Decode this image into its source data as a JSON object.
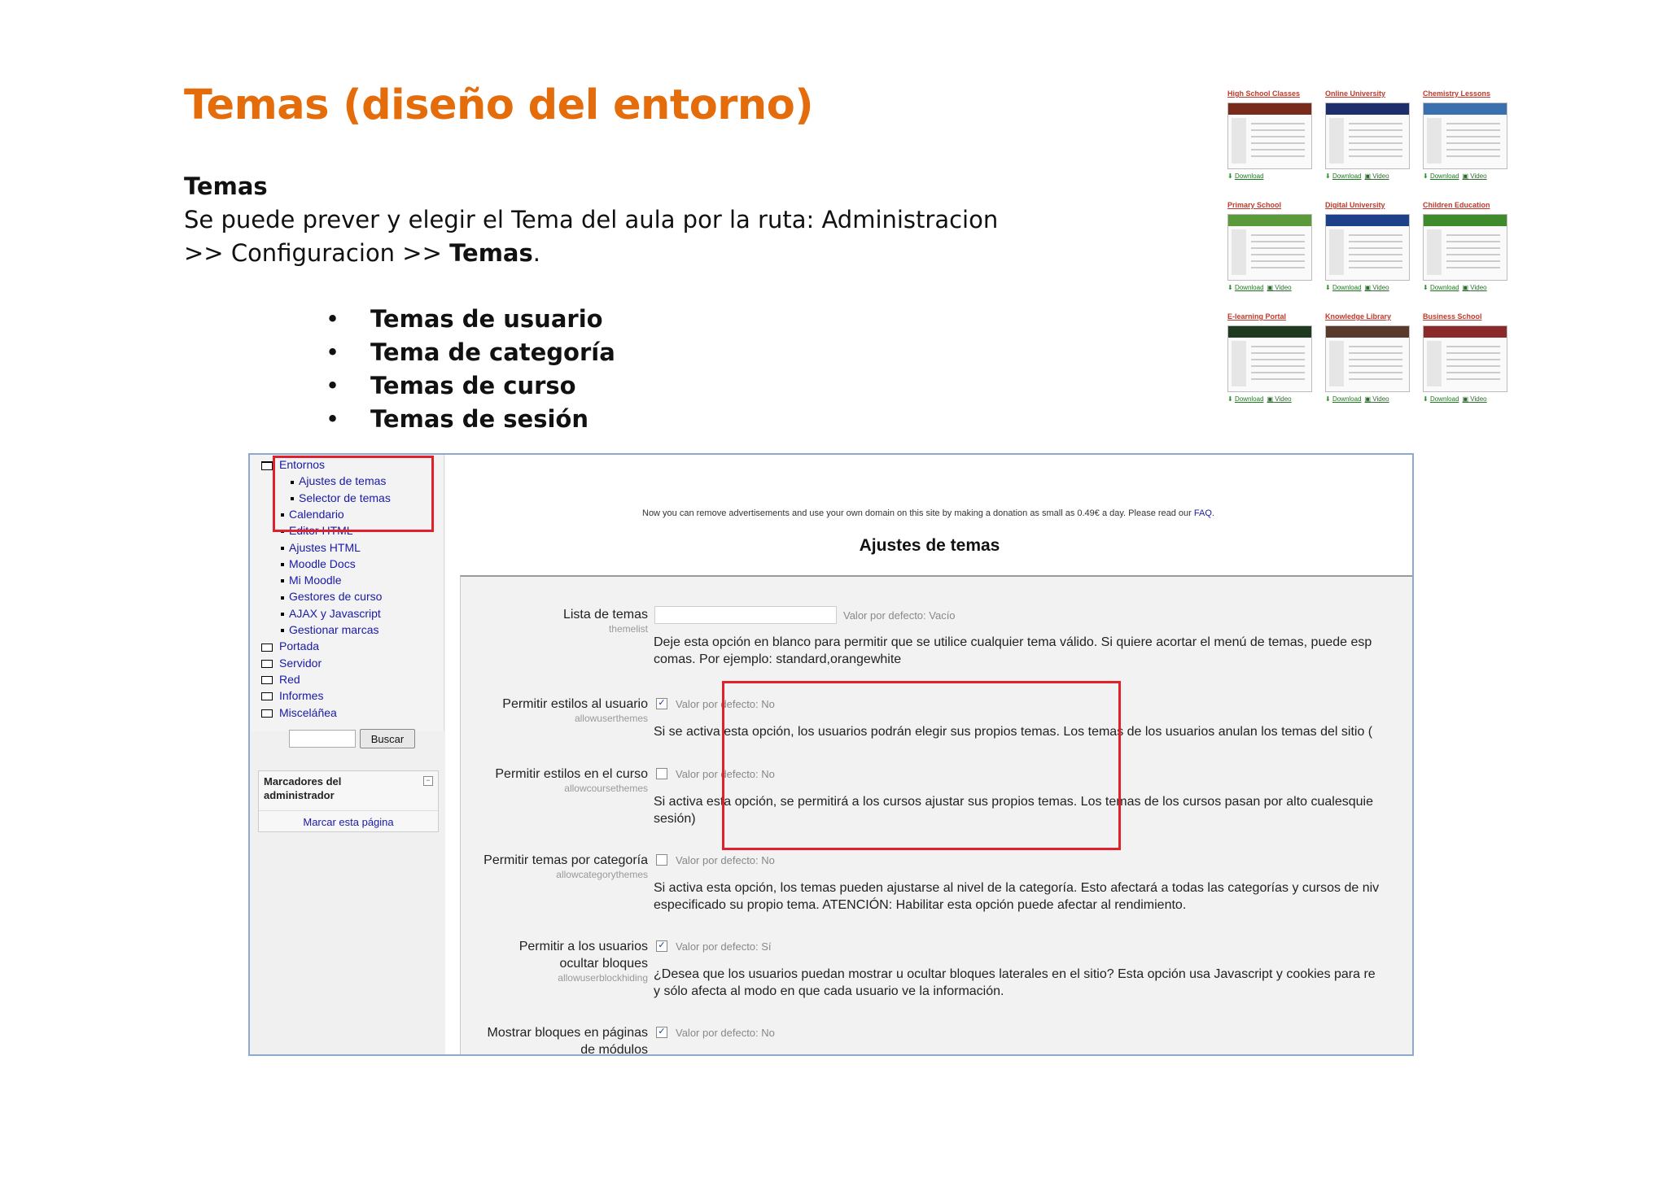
{
  "slide": {
    "title": "Temas (diseño del entorno)",
    "heading": "Temas",
    "intro_prefix": "Se puede prever y elegir el Tema del aula por la ruta: Administracion >> Configuracion >> ",
    "intro_bold": "Temas",
    "intro_suffix": ".",
    "bullet_glyph": "•",
    "bullets": [
      "Temas de usuario",
      "Tema de categoría",
      "Temas de curso",
      "Temas de sesión"
    ]
  },
  "gallery": {
    "download_label": "Download",
    "video_label": "Video",
    "themes": [
      {
        "title": "High School Classes",
        "color": "#7a2a1a",
        "video": false
      },
      {
        "title": "Online University",
        "color": "#1d2d6e",
        "video": true
      },
      {
        "title": "Chemistry Lessons",
        "color": "#3a6fb0",
        "video": true
      },
      {
        "title": "Primary School",
        "color": "#5a9a3a",
        "video": true
      },
      {
        "title": "Digital University",
        "color": "#1e3f8a",
        "video": true
      },
      {
        "title": "Children Education",
        "color": "#3f8a2a",
        "video": true
      },
      {
        "title": "E-learning Portal",
        "color": "#1f3a1f",
        "video": true
      },
      {
        "title": "Knowledge Library",
        "color": "#5a3a2a",
        "video": true
      },
      {
        "title": "Business School",
        "color": "#8a2a2a",
        "video": true
      }
    ]
  },
  "screenshot": {
    "sidebar": {
      "items": [
        {
          "label": "Entornos",
          "kind": "folder-open",
          "indent": 0
        },
        {
          "label": "Ajustes de temas",
          "kind": "leaf",
          "indent": 2
        },
        {
          "label": "Selector de temas",
          "kind": "leaf",
          "indent": 2
        },
        {
          "label": "Calendario",
          "kind": "leaf",
          "indent": 1
        },
        {
          "label": "Editor HTML",
          "kind": "leaf",
          "indent": 1
        },
        {
          "label": "Ajustes HTML",
          "kind": "leaf",
          "indent": 1
        },
        {
          "label": "Moodle Docs",
          "kind": "leaf",
          "indent": 1
        },
        {
          "label": "Mi Moodle",
          "kind": "leaf",
          "indent": 1
        },
        {
          "label": "Gestores de curso",
          "kind": "leaf",
          "indent": 1
        },
        {
          "label": "AJAX y Javascript",
          "kind": "leaf",
          "indent": 1
        },
        {
          "label": "Gestionar marcas",
          "kind": "leaf",
          "indent": 1
        },
        {
          "label": "Portada",
          "kind": "folder",
          "indent": 0
        },
        {
          "label": "Servidor",
          "kind": "folder",
          "indent": 0
        },
        {
          "label": "Red",
          "kind": "folder",
          "indent": 0
        },
        {
          "label": "Informes",
          "kind": "folder",
          "indent": 0
        },
        {
          "label": "Misceláñea",
          "kind": "folder",
          "indent": 0
        }
      ],
      "search_button": "Buscar",
      "bookmarks_title": "Marcadores del administrador",
      "bookmarks_link": "Marcar esta página"
    },
    "notice_text": "Now you can remove advertisements and use your own domain on this site by making a donation as small as 0.49€ a day. Please read our ",
    "notice_link": "FAQ",
    "notice_end": ".",
    "page_heading": "Ajustes de temas",
    "settings": [
      {
        "label": "Lista de temas",
        "key": "themelist",
        "control": "text",
        "default": "Valor por defecto: Vacío",
        "description": "Deje esta opción en blanco para permitir que se utilice cualquier tema válido. Si quiere acortar el menú de temas, puede esp\ncomas. Por ejemplo: standard,orangewhite"
      },
      {
        "label": "Permitir estilos al usuario",
        "key": "allowuserthemes",
        "control": "checkbox",
        "checked": true,
        "default": "Valor por defecto: No",
        "description": "Si se activa esta opción, los usuarios podrán elegir sus propios temas. Los temas de los usuarios anulan los temas del sitio ("
      },
      {
        "label": "Permitir estilos en el curso",
        "key": "allowcoursethemes",
        "control": "checkbox",
        "checked": false,
        "default": "Valor por defecto: No",
        "description": "Si activa esta opción, se permitirá a los cursos ajustar sus propios temas. Los temas de los cursos pasan por alto cualesquie\nsesión)"
      },
      {
        "label": "Permitir temas por categoría",
        "key": "allowcategorythemes",
        "control": "checkbox",
        "checked": false,
        "default": "Valor por defecto: No",
        "description": "Si activa esta opción, los temas pueden ajustarse al nivel de la categoría. Esto afectará a todas las categorías y cursos de niv\nespecificado su propio tema. ATENCIÓN: Habilitar esta opción puede afectar al rendimiento."
      },
      {
        "label": "Permitir a los usuarios\nocultar bloques",
        "key": "allowuserblockhiding",
        "control": "checkbox",
        "checked": true,
        "default": "Valor por defecto: Sí",
        "description": "¿Desea que los usuarios puedan mostrar u ocultar bloques laterales en el sitio? Esta opción usa Javascript y cookies para re\ny sólo afecta al modo en que cada usuario ve la información."
      },
      {
        "label": "Mostrar bloques en páginas\nde módulos",
        "key": "",
        "control": "checkbox",
        "checked": true,
        "default": "Valor por defecto: No",
        "description": ""
      }
    ],
    "checkmark_glyph": "✓",
    "collapse_glyph": "−",
    "highlight_color": "#e0202a"
  }
}
